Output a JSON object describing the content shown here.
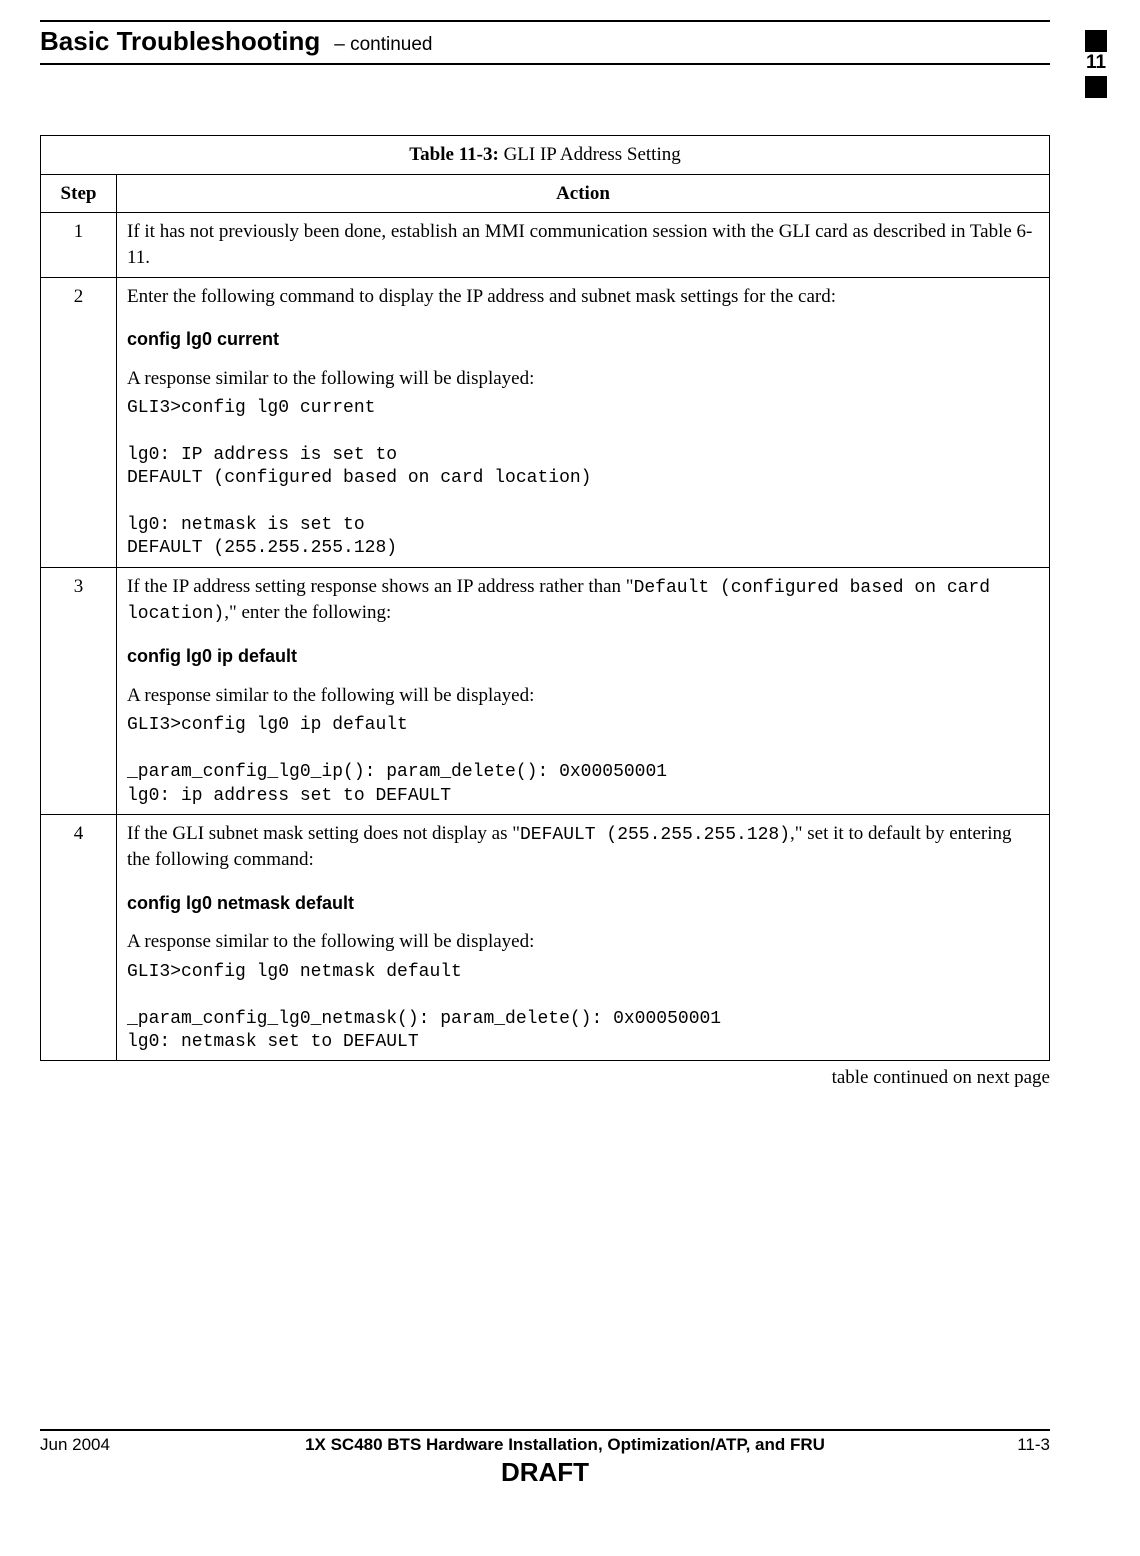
{
  "header": {
    "title": "Basic Troubleshooting",
    "continued": "– continued"
  },
  "side_tab": {
    "number": "11"
  },
  "table": {
    "title_bold": "Table 11-3:",
    "title_rest": " GLI IP Address Setting",
    "col_step": "Step",
    "col_action": "Action",
    "rows": [
      {
        "step": "1",
        "p1": "If it has not previously been done, establish an MMI communication session with the GLI card as described in Table 6-11."
      },
      {
        "step": "2",
        "p1": "Enter the following command to display the IP address and subnet mask settings for the card:",
        "cmd": "config lg0 current",
        "p2": "A response similar to the following will be displayed:",
        "mono": "GLI3>config lg0 current\n\nlg0: IP address is set to\nDEFAULT (configured based on card location)\n\nlg0: netmask is set to\nDEFAULT (255.255.255.128)"
      },
      {
        "step": "3",
        "p1a": "If the IP address setting response shows an IP address rather than \"",
        "p1_mono": "Default (configured based on card location)",
        "p1b": ",\" enter the following:",
        "cmd": "config lg0 ip default",
        "p2": "A response similar to the following will be displayed:",
        "mono": "GLI3>config lg0 ip default\n\n_param_config_lg0_ip(): param_delete(): 0x00050001\nlg0: ip address set to DEFAULT"
      },
      {
        "step": "4",
        "p1a": "If the GLI subnet mask setting does not display as \"",
        "p1_mono": "DEFAULT (255.255.255.128)",
        "p1b": ",\" set it to default by entering the following command:",
        "cmd": "config lg0 netmask default",
        "p2": "A response similar to the following will be displayed:",
        "mono": "GLI3>config lg0 netmask default\n\n_param_config_lg0_netmask(): param_delete(): 0x00050001\nlg0: netmask set to DEFAULT"
      }
    ],
    "continued_note": "table continued on next page"
  },
  "footer": {
    "date": "Jun 2004",
    "center": "1X SC480 BTS Hardware Installation, Optimization/ATP, and FRU",
    "page": "11-3",
    "draft": "DRAFT"
  }
}
